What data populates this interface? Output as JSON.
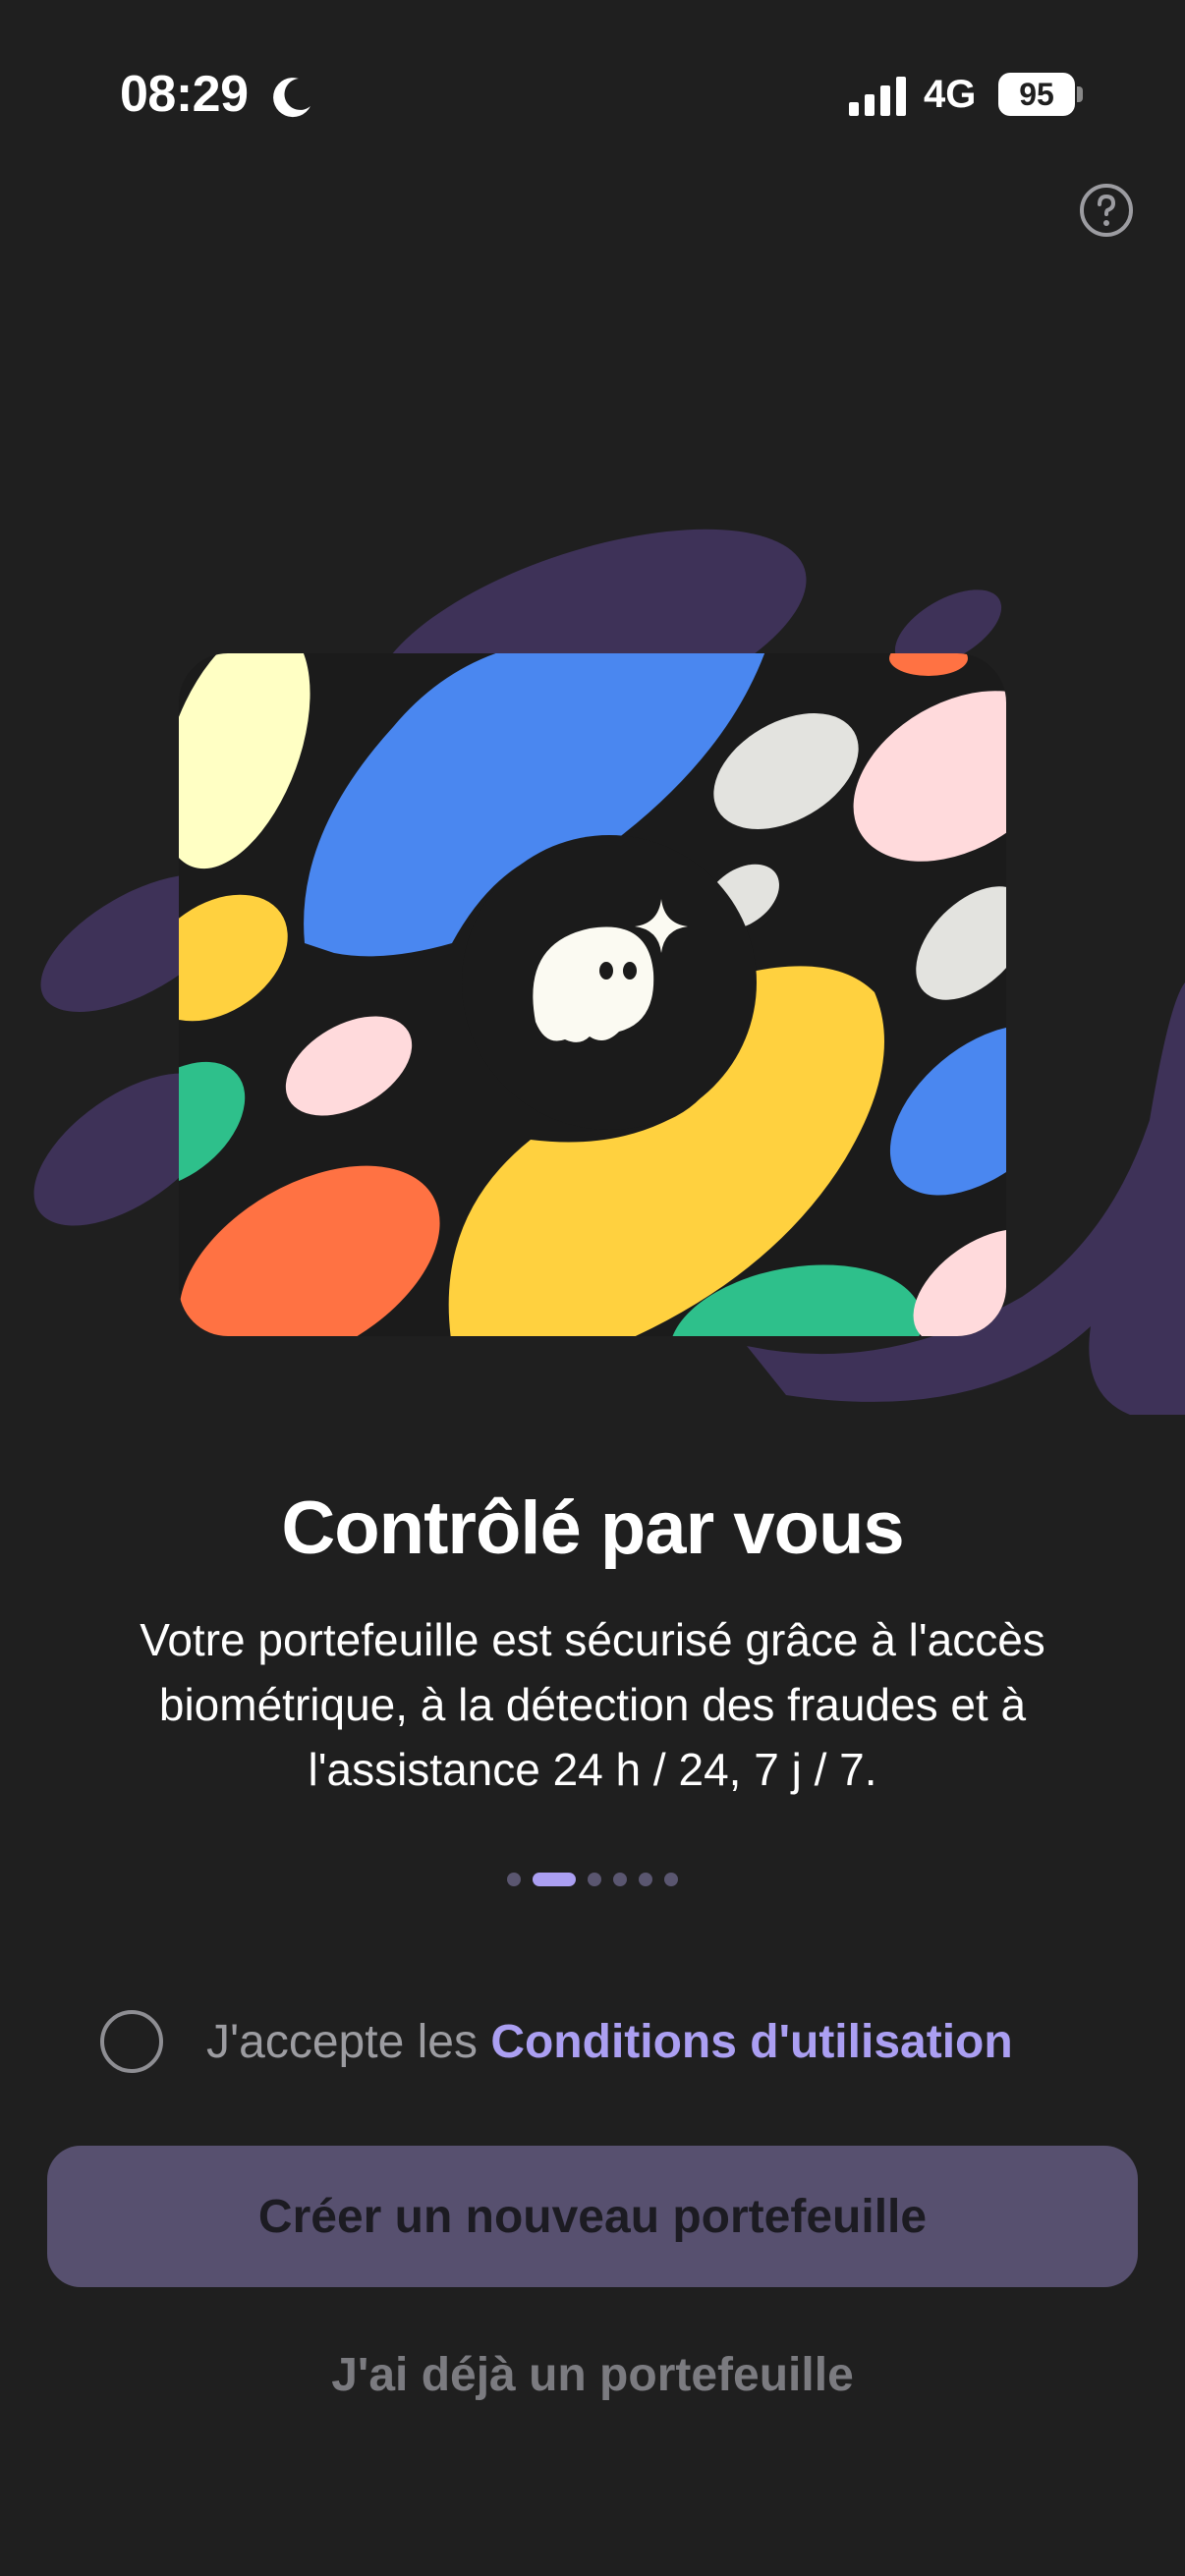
{
  "status_bar": {
    "time": "08:29",
    "network": "4G",
    "battery": "95"
  },
  "icons": {
    "help": "help-circle-icon",
    "moon": "moon-icon",
    "signal": "cellular-signal-icon"
  },
  "onboarding": {
    "title": "Contrôlé par vous",
    "description": "Votre portefeuille est sécurisé grâce à l'accès biométrique, à la détection des fraudes et à l'assistance 24 h / 24, 7 j / 7.",
    "pager": {
      "total": 6,
      "active_index": 1
    }
  },
  "terms": {
    "prefix": "J'accepte les ",
    "link": "Conditions d'utilisation",
    "checked": false
  },
  "actions": {
    "create_wallet": "Créer un nouveau portefeuille",
    "existing_wallet": "J'ai déjà un portefeuille"
  },
  "colors": {
    "background": "#1f1f1f",
    "accent": "#ab9ff2",
    "button_disabled": "#57506f",
    "purple_dark": "#3e3258",
    "blue": "#4a87f0",
    "yellow": "#ffd13f",
    "orange": "#ff7243",
    "green": "#2ec08b",
    "pink": "#ffdadc",
    "cream": "#ffffc4",
    "light_gray": "#e3e3df"
  }
}
